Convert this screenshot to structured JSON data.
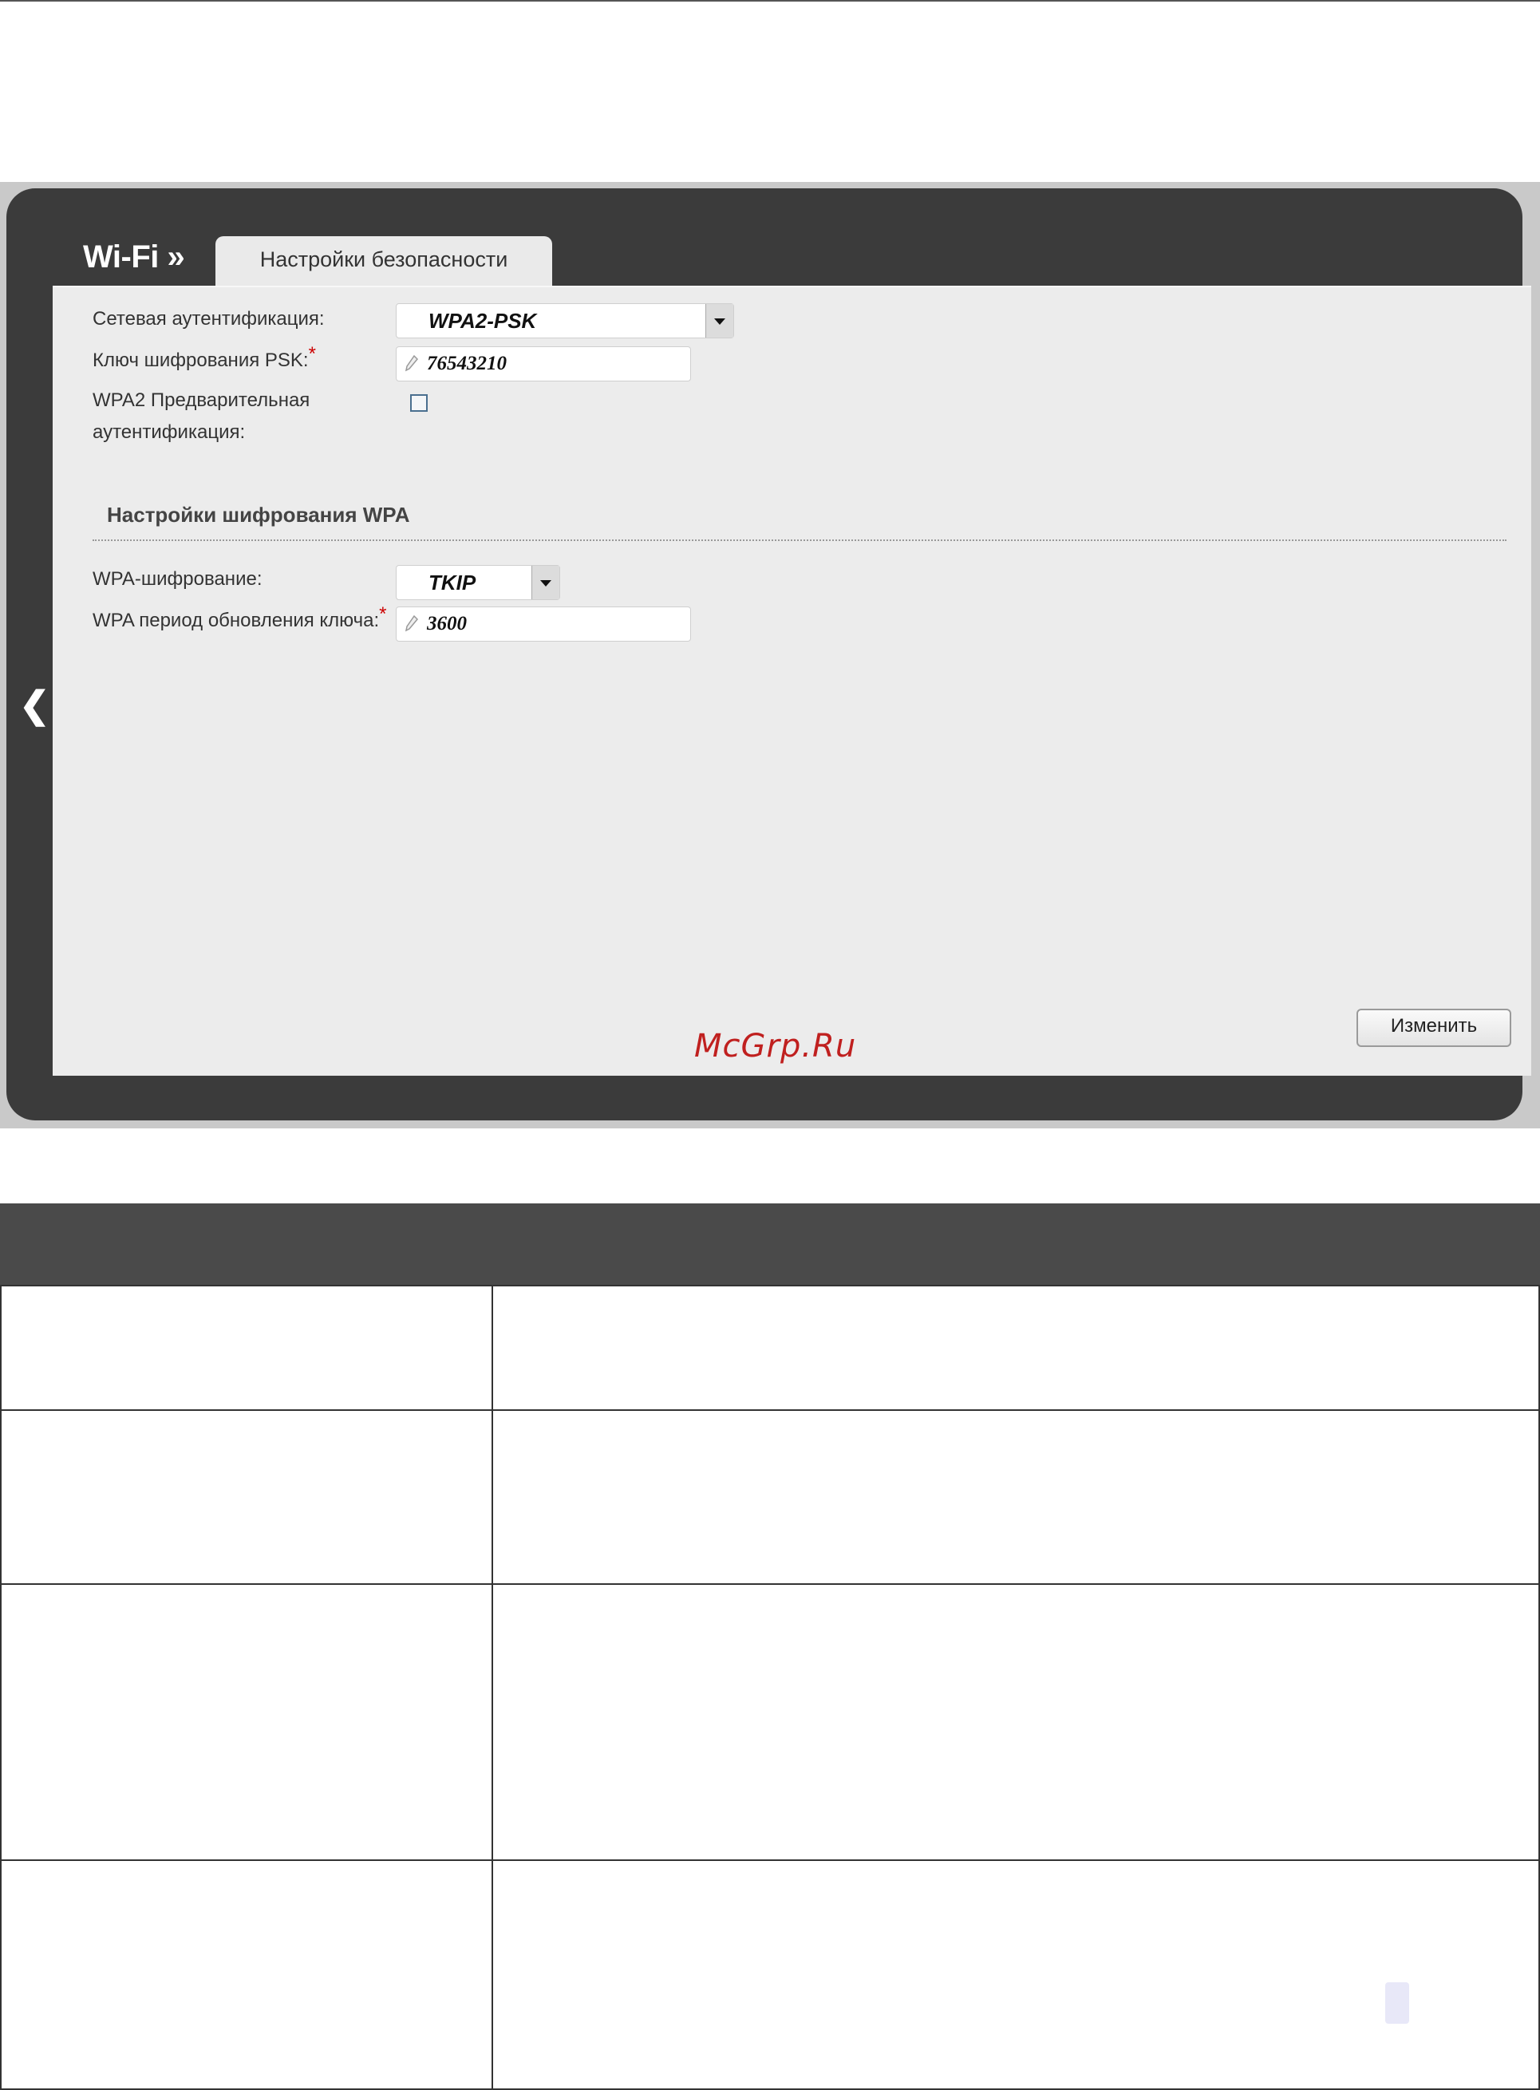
{
  "header": {
    "section": "Wi-Fi »",
    "tab": "Настройки безопасности"
  },
  "form": {
    "auth_label": "Сетевая аутентификация:",
    "auth_value": "WPA2-PSK",
    "psk_label": "Ключ шифрования PSK:",
    "psk_value": "76543210",
    "preauth_label_1": "WPA2 Предварительная",
    "preauth_label_2": "аутентификация:",
    "preauth_checked": false,
    "required_mark": "*"
  },
  "wpa_section": {
    "title": "Настройки шифрования WPA",
    "enc_label": "WPA-шифрование:",
    "enc_value": "TKIP",
    "rekey_label": "WPA период обновления ключа:",
    "rekey_value": "3600"
  },
  "actions": {
    "change_label": "Изменить"
  },
  "watermark": "McGrp.Ru",
  "colors": {
    "frame": "#3b3b3b",
    "panel": "#ececec",
    "table_header": "#4a4a4a",
    "required": "#cc0000",
    "watermark": "#c0201f"
  }
}
